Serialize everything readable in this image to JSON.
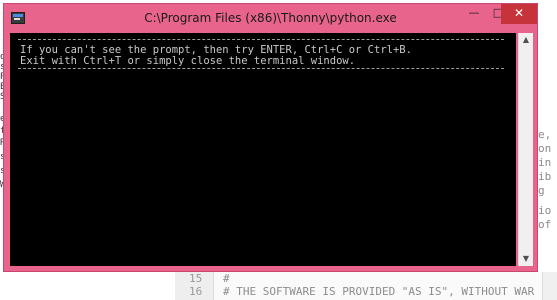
{
  "window": {
    "title": "C:\\Program Files (x86)\\Thonny\\python.exe",
    "minimize_glyph": "—",
    "maximize_glyph": "□",
    "close_glyph": "✕",
    "app_icon": "console-app-icon",
    "frame_color": "#e8648c",
    "close_color": "#c7333b"
  },
  "console": {
    "lines": [
      "If you can't see the prompt, then try ENTER, Ctrl+C or Ctrl+B.",
      "Exit with Ctrl+T or simply close the terminal window."
    ],
    "background": "#000000",
    "text_color": "#c8c8c8"
  },
  "scrollbar": {
    "up_glyph": "▲",
    "down_glyph": "▼"
  },
  "background_editor": {
    "left_fragments": [
      "o",
      "s",
      "P",
      "E",
      "S",
      "es",
      "fi",
      "RE",
      "st",
      "st",
      "W"
    ],
    "right_fragments": [
      "e,",
      "on",
      "in",
      "ib",
      "g",
      "io",
      "of"
    ],
    "line_numbers": [
      "15",
      "16"
    ],
    "code_lines": [
      "#",
      "# THE SOFTWARE IS PROVIDED \"AS IS\", WITHOUT WAR"
    ]
  }
}
